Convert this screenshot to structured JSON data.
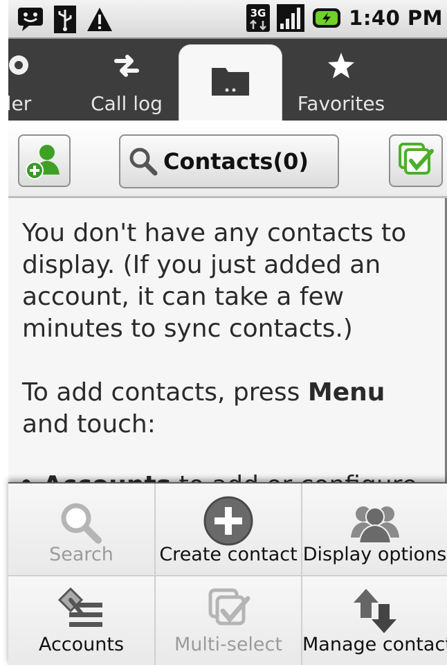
{
  "status_bar": {
    "time": "1:40 PM",
    "network": "3G",
    "icons": [
      "chat-notification-icon",
      "usb-icon",
      "warning-icon",
      "3g-data-icon",
      "signal-icon",
      "battery-icon"
    ]
  },
  "tabs": [
    {
      "label": "ler",
      "icon": "dialer-icon"
    },
    {
      "label": "Call log",
      "icon": "call-log-icon"
    },
    {
      "label": "",
      "icon": "contacts-folder-icon",
      "selected": true
    },
    {
      "label": "Favorites",
      "icon": "star-icon"
    }
  ],
  "toolbar": {
    "add_icon": "add-contact-icon",
    "search_label": "Contacts(0)",
    "multi_icon": "multi-select-icon"
  },
  "content": {
    "p1": "You don't have any contacts to display. (If you just added an account, it can take a few minutes to sync contacts.)",
    "p2_before": "To add contacts, press ",
    "p2_bold": "Menu",
    "p2_after": " and touch:",
    "bullet1_bold": "Accounts",
    "bullet1_rest": " to add or configure"
  },
  "menu": {
    "items": [
      {
        "label": "Search",
        "icon": "search-icon",
        "enabled": false
      },
      {
        "label": "Create contact",
        "icon": "create-contact-icon",
        "enabled": true
      },
      {
        "label": "Display options",
        "icon": "display-options-icon",
        "enabled": true
      },
      {
        "label": "Accounts",
        "icon": "accounts-icon",
        "enabled": true
      },
      {
        "label": "Multi-select",
        "icon": "multi-select-icon",
        "enabled": false
      },
      {
        "label": "Manage contacts",
        "icon": "manage-contacts-icon",
        "enabled": true
      }
    ]
  },
  "colors": {
    "tab_bg": "#3d3d3d",
    "accent_green": "#4caf2a",
    "disabled_text": "#9b9b9b"
  }
}
